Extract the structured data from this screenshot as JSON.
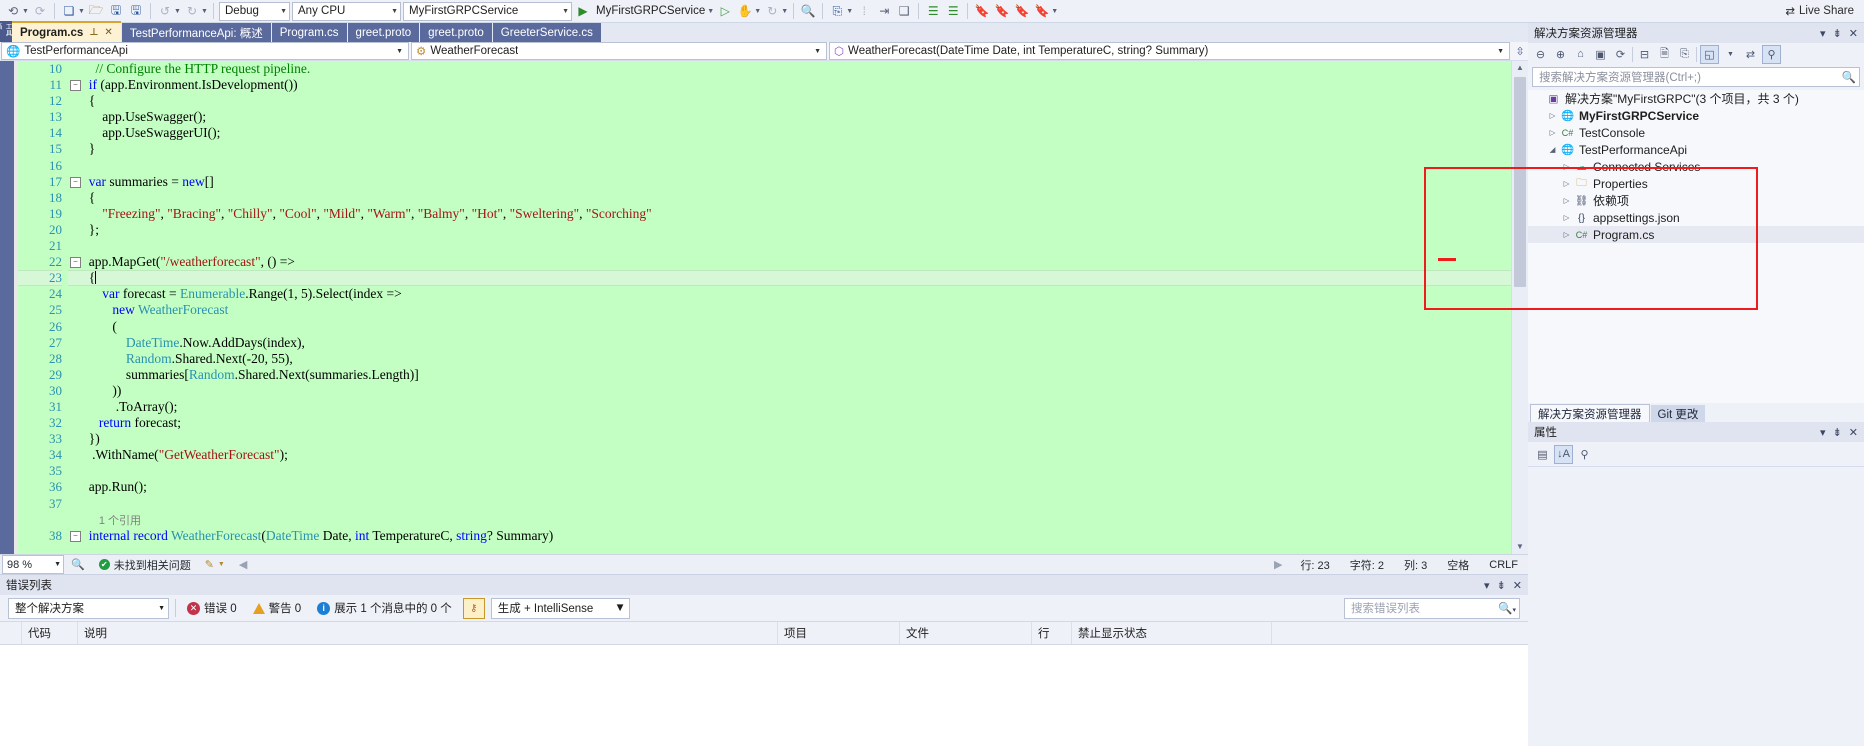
{
  "toolbar": {
    "config_value": "Debug",
    "platform_value": "Any CPU",
    "startup_project_value": "MyFirstGRPCService",
    "run_label": "MyFirstGRPCService",
    "live_share_label": "Live Share",
    "icons": [
      "navigate-back-icon",
      "navigate-forward-icon",
      "new-item-icon",
      "open-file-icon",
      "save-icon",
      "save-all-icon",
      "undo-icon",
      "redo-icon",
      "start-debug-icon",
      "pause-icon",
      "stop-icon",
      "attach-process-icon",
      "step-icon",
      "step-into-icon",
      "step-over-icon",
      "comment-icon",
      "uncomment-icon",
      "bookmark-icon",
      "prev-bookmark-icon",
      "next-bookmark-icon",
      "clear-bookmarks-icon"
    ]
  },
  "tabs": {
    "items": [
      {
        "label": "Program.cs",
        "active": true
      },
      {
        "label": "TestPerformanceApi: 概述",
        "active": false
      },
      {
        "label": "Program.cs",
        "active": false
      },
      {
        "label": "greet.proto",
        "active": false
      },
      {
        "label": "greet.proto",
        "active": false
      },
      {
        "label": "GreeterService.cs",
        "active": false
      }
    ],
    "pin_glyph": "⊥",
    "close_glyph": "✕",
    "vertical_label": "工具箱"
  },
  "navbar": {
    "project": "TestPerformanceApi",
    "type": "WeatherForecast",
    "member": "WeatherForecast(DateTime Date, int TemperatureC, string? Summary)"
  },
  "editor": {
    "first_line": 10,
    "current_line": 23,
    "lines": [
      {
        "n": 10,
        "html": "    <span class='cm'>// Configure the HTTP request pipeline.</span>"
      },
      {
        "n": 11,
        "html": "  <span class='kw'>if</span> (app.Environment.IsDevelopment())",
        "fold": true
      },
      {
        "n": 12,
        "html": "  {"
      },
      {
        "n": 13,
        "html": "      app.UseSwagger();"
      },
      {
        "n": 14,
        "html": "      app.UseSwaggerUI();"
      },
      {
        "n": 15,
        "html": "  }"
      },
      {
        "n": 16,
        "html": ""
      },
      {
        "n": 17,
        "html": "  <span class='kw'>var</span> summaries = <span class='kw'>new</span>[]",
        "fold": true
      },
      {
        "n": 18,
        "html": "  {"
      },
      {
        "n": 19,
        "html": "      <span class='st'>\"Freezing\"</span>, <span class='st'>\"Bracing\"</span>, <span class='st'>\"Chilly\"</span>, <span class='st'>\"Cool\"</span>, <span class='st'>\"Mild\"</span>, <span class='st'>\"Warm\"</span>, <span class='st'>\"Balmy\"</span>, <span class='st'>\"Hot\"</span>, <span class='st'>\"Sweltering\"</span>, <span class='st'>\"Scorching\"</span>"
      },
      {
        "n": 20,
        "html": "  };"
      },
      {
        "n": 21,
        "html": ""
      },
      {
        "n": 22,
        "html": "  app.MapGet(<span class='st'>\"/weatherforecast\"</span>, () =&gt;",
        "fold": true
      },
      {
        "n": 23,
        "html": "  {<span class='caret'></span>",
        "current": true
      },
      {
        "n": 24,
        "html": "      <span class='kw'>var</span> forecast = <span class='ty'>Enumerable</span>.Range(1, 5).Select(index =&gt;"
      },
      {
        "n": 25,
        "html": "         <span class='kw'>new</span> <span class='ty'>WeatherForecast</span>"
      },
      {
        "n": 26,
        "html": "         ("
      },
      {
        "n": 27,
        "html": "             <span class='ty'>DateTime</span>.Now.AddDays(index),"
      },
      {
        "n": 28,
        "html": "             <span class='ty'>Random</span>.Shared.Next(-20, 55),"
      },
      {
        "n": 29,
        "html": "             summaries[<span class='ty'>Random</span>.Shared.Next(summaries.Length)]"
      },
      {
        "n": 30,
        "html": "         ))"
      },
      {
        "n": 31,
        "html": "          .ToArray();"
      },
      {
        "n": 32,
        "html": "     <span class='kw'>return</span> forecast;"
      },
      {
        "n": 33,
        "html": "  })"
      },
      {
        "n": 34,
        "html": "   .WithName(<span class='st'>\"GetWeatherForecast\"</span>);"
      },
      {
        "n": 35,
        "html": ""
      },
      {
        "n": 36,
        "html": "  app.Run();"
      },
      {
        "n": 37,
        "html": ""
      },
      {
        "n": "ref",
        "html": "     <span class='ref'>1 个引用</span>"
      },
      {
        "n": 38,
        "html": "  <span class='kw'>internal</span> <span class='kw'>record</span> <span class='ty'>WeatherForecast</span>(<span class='ty'>DateTime</span> Date, <span class='kw'>int</span> TemperatureC, <span class='kw'>string</span>? Summary)",
        "fold": true
      }
    ]
  },
  "editor_status": {
    "zoom": "98 %",
    "issues": "未找到相关问题",
    "line": "行: 23",
    "char": "字符: 2",
    "column": "列: 3",
    "spaces": "空格",
    "eol": "CRLF"
  },
  "error_list": {
    "title": "错误列表",
    "scope": "整个解决方案",
    "errors": "错误 0",
    "warnings": "警告 0",
    "messages": "展示 1 个消息中的 0 个",
    "build_filter": "生成 + IntelliSense",
    "search_placeholder": "搜索错误列表",
    "columns": [
      "",
      "代码",
      "说明",
      "项目",
      "文件",
      "行",
      "禁止显示状态"
    ],
    "rows": []
  },
  "solution_explorer": {
    "title": "解决方案资源管理器",
    "search_placeholder": "搜索解决方案资源管理器(Ctrl+;)",
    "toolbar_icons": [
      "back-icon",
      "forward-icon",
      "home-icon",
      "solution-view-icon",
      "refresh-icon",
      "collapse-all-icon",
      "show-all-files-icon",
      "properties-icon",
      "preview-icon",
      "sync-icon",
      "filter-icon",
      "search-icon"
    ],
    "tree": [
      {
        "indent": 0,
        "arrow": "",
        "icon": "solution-icon",
        "label": "解决方案\"MyFirstGRPC\"(3 个项目，共 3 个)",
        "bold": false
      },
      {
        "indent": 1,
        "arrow": "▷",
        "icon": "web-project-icon",
        "label": "MyFirstGRPCService",
        "bold": true
      },
      {
        "indent": 1,
        "arrow": "▷",
        "icon": "csharp-project-icon",
        "label": "TestConsole",
        "bold": false
      },
      {
        "indent": 1,
        "arrow": "◢",
        "icon": "web-project-icon",
        "label": "TestPerformanceApi",
        "bold": false
      },
      {
        "indent": 2,
        "arrow": "▷",
        "icon": "connected-services-icon",
        "label": "Connected Services",
        "bold": false
      },
      {
        "indent": 2,
        "arrow": "▷",
        "icon": "properties-folder-icon",
        "label": "Properties",
        "bold": false
      },
      {
        "indent": 2,
        "arrow": "▷",
        "icon": "dependencies-icon",
        "label": "依赖项",
        "bold": false
      },
      {
        "indent": 2,
        "arrow": "▷",
        "icon": "json-file-icon",
        "label": "appsettings.json",
        "bold": false
      },
      {
        "indent": 2,
        "arrow": "▷",
        "icon": "csharp-file-icon",
        "label": "Program.cs",
        "bold": false,
        "selected": true
      }
    ],
    "tabs": [
      {
        "label": "解决方案资源管理器",
        "active": true
      },
      {
        "label": "Git 更改",
        "active": false
      }
    ]
  },
  "properties": {
    "title": "属性",
    "toolbar_icons": [
      "categorized-icon",
      "alphabetical-icon",
      "properties-icon"
    ]
  },
  "colors": {
    "accent": "#4a5a8c",
    "editor_background": "#c3ffc3",
    "highlight_box": "#ee1c1c",
    "keyword": "#0000ff",
    "type": "#2b91af",
    "string": "#a31515",
    "comment": "#008000"
  }
}
